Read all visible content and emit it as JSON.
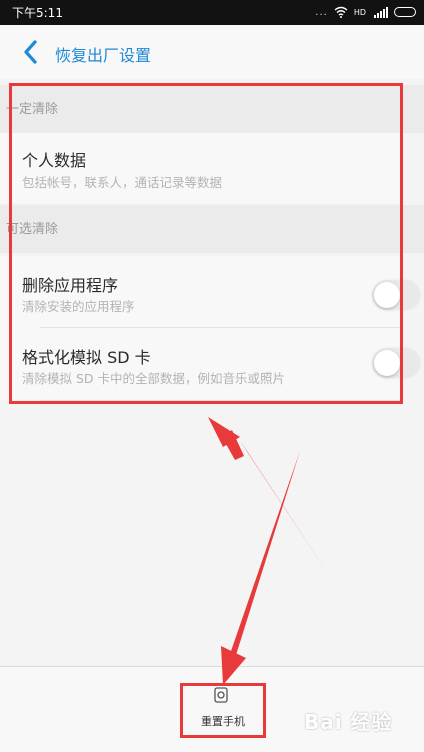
{
  "status_bar": {
    "time": "下午5:11",
    "dots": "...",
    "network": "HD",
    "icons": [
      "wifi-icon",
      "signal-icon",
      "battery-icon"
    ]
  },
  "header": {
    "back_icon": "chevron-left-icon",
    "title": "恢复出厂设置"
  },
  "sections": [
    {
      "header": "一定清除",
      "items": [
        {
          "title": "个人数据",
          "subtitle": "包括帐号，联系人，通话记录等数据"
        }
      ]
    },
    {
      "header": "可选清除",
      "items": [
        {
          "title": "删除应用程序",
          "subtitle": "清除安装的应用程序",
          "toggle": false
        },
        {
          "title": "格式化模拟 SD 卡",
          "subtitle": "清除模拟 SD 卡中的全部数据，例如音乐或照片",
          "toggle": false
        }
      ]
    }
  ],
  "bottom_bar": {
    "reset_icon": "phone-reset-icon",
    "reset_label": "重置手机"
  },
  "watermark": "Bai 经验",
  "colors": {
    "accent": "#1f8ad6",
    "annotation": "#e83a3a",
    "status_bar": "#121212"
  }
}
